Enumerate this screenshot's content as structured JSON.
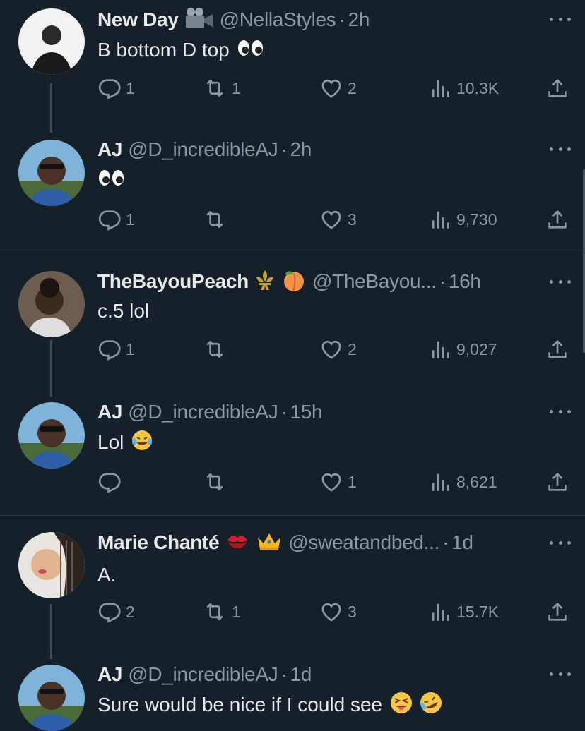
{
  "tweets": [
    {
      "name": "New Day",
      "handle": "@NellaStyles",
      "time": "2h",
      "text": "B bottom D top",
      "replies": "1",
      "retweets": "1",
      "likes": "2",
      "views": "10.3K"
    },
    {
      "name": "AJ",
      "handle": "@D_incredibleAJ",
      "time": "2h",
      "text": "",
      "replies": "1",
      "retweets": "",
      "likes": "3",
      "views": "9,730"
    },
    {
      "name": "TheBayouPeach",
      "handle": "@TheBayou...",
      "time": "16h",
      "text": "c.5 lol",
      "replies": "1",
      "retweets": "",
      "likes": "2",
      "views": "9,027"
    },
    {
      "name": "AJ",
      "handle": "@D_incredibleAJ",
      "time": "15h",
      "text": "Lol",
      "replies": "",
      "retweets": "",
      "likes": "1",
      "views": "8,621"
    },
    {
      "name": "Marie Chanté",
      "handle": "@sweatandbed...",
      "time": "1d",
      "text": "A.",
      "replies": "2",
      "retweets": "1",
      "likes": "3",
      "views": "15.7K"
    },
    {
      "name": "AJ",
      "handle": "@D_incredibleAJ",
      "time": "1d",
      "text": "Sure would be nice if I could see",
      "replies": "",
      "retweets": "",
      "likes": "",
      "views": ""
    }
  ],
  "separator": "·",
  "icons": {
    "reply": "reply-icon",
    "retweet": "retweet-icon",
    "like": "heart-icon",
    "views": "views-icon",
    "share": "share-icon",
    "more": "more-icon"
  },
  "colors": {
    "background": "#15202b",
    "text": "#e7e9ea",
    "muted": "#8b98a5",
    "divider": "#2f3b47"
  }
}
